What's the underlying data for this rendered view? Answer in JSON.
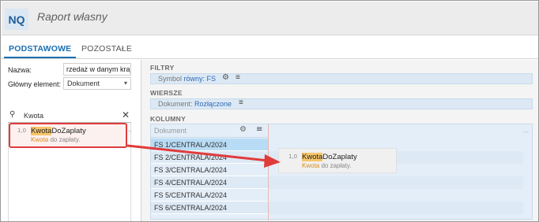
{
  "header": {
    "logo": "NQ",
    "title": "Raport własny"
  },
  "tabs": [
    {
      "label": "PODSTAWOWE"
    },
    {
      "label": "POZOSTAŁE"
    }
  ],
  "form": {
    "name_label": "Nazwa:",
    "name_value": "rzedaż w danym kraju",
    "main_label": "Główny element:",
    "main_value": "Dokument"
  },
  "search": {
    "query": "Kwota"
  },
  "field_item": {
    "type": "1,0",
    "name_hl": "Kwota",
    "name_rest": "DoZaplaty",
    "desc_hl": "Kwota",
    "desc_rest": " do zapłaty."
  },
  "filtry": {
    "title": "FILTRY",
    "chip_label": "Symbol ",
    "chip_value": "równy: FS"
  },
  "wiersze": {
    "title": "WIERSZE",
    "chip_label": "Dokument: ",
    "chip_value": "Rozłączone"
  },
  "kolumny": {
    "title": "KOLUMNY",
    "column_header": "Dokument",
    "rows": [
      "FS 1/CENTRALA/2024",
      "FS 2/CENTRALA/2024",
      "FS 3/CENTRALA/2024",
      "FS 4/CENTRALA/2024",
      "FS 5/CENTRALA/2024",
      "FS 6/CENTRALA/2024"
    ]
  },
  "colors": {
    "accent": "#1a6fb3",
    "highlight": "#f7c56a",
    "annotation": "#e03b3b",
    "selected_row": "#b8dcf5"
  },
  "icons": [
    "search-icon",
    "close-icon",
    "gear-icon",
    "menu-icon",
    "chevron-down-icon",
    "chevron-up-icon"
  ]
}
